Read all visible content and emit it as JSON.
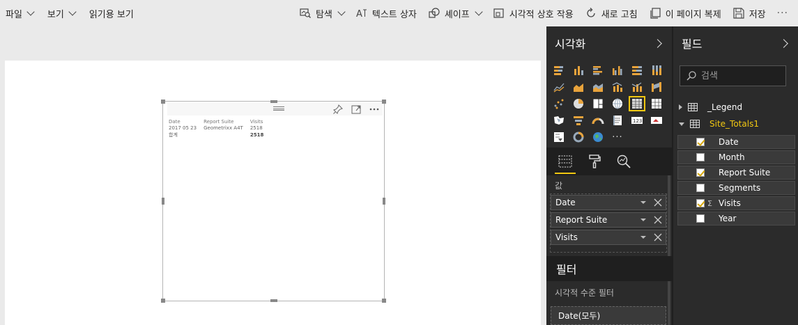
{
  "ribbon": {
    "menus": [
      {
        "label": "파일",
        "dropdown": true
      },
      {
        "label": "보기",
        "dropdown": true
      },
      {
        "label": "읽기용 보기",
        "dropdown": false
      }
    ],
    "tools": [
      {
        "label": "탐색",
        "icon": "explore-icon",
        "dropdown": true
      },
      {
        "label": "텍스트 상자",
        "icon": "textbox-icon",
        "dropdown": false
      },
      {
        "label": "셰이프",
        "icon": "shapes-icon",
        "dropdown": true
      },
      {
        "label": "시각적 상호 작용",
        "icon": "interactions-icon",
        "dropdown": false
      },
      {
        "label": "새로 고침",
        "icon": "refresh-icon",
        "dropdown": false
      },
      {
        "label": "이 페이지 복제",
        "icon": "duplicate-page-icon",
        "dropdown": false
      },
      {
        "label": "저장",
        "icon": "save-icon",
        "dropdown": false
      }
    ],
    "more": "···"
  },
  "visual": {
    "table": {
      "headers": [
        "Date",
        "Report Suite",
        "Visits"
      ],
      "rows": [
        [
          "2017 05 23",
          "Geometrixx A4T",
          "2518"
        ]
      ],
      "total": [
        "합계",
        "",
        "2518"
      ]
    }
  },
  "viz_pane": {
    "title": "시각화",
    "values_label": "값",
    "value_wells": [
      "Date",
      "Report Suite",
      "Visits"
    ],
    "more": "···",
    "filter_title": "필터",
    "filter_subtitle": "시각적 수준 필터",
    "filter_items": [
      "Date(모두)"
    ]
  },
  "fields_pane": {
    "title": "필드",
    "search_placeholder": "검색",
    "tables": [
      {
        "name": "_Legend",
        "expanded": false
      },
      {
        "name": "Site_Totals1",
        "expanded": true
      }
    ],
    "fields": [
      {
        "name": "Date",
        "checked": true,
        "sigma": false
      },
      {
        "name": "Month",
        "checked": false,
        "sigma": false
      },
      {
        "name": "Report Suite",
        "checked": true,
        "sigma": false
      },
      {
        "name": "Segments",
        "checked": false,
        "sigma": false
      },
      {
        "name": "Visits",
        "checked": true,
        "sigma": true
      },
      {
        "name": "Year",
        "checked": false,
        "sigma": false
      }
    ]
  },
  "colors": {
    "accent": "#f2c811",
    "pane_bg": "#2b2b2b",
    "canvas_bg": "#eaeaea"
  }
}
